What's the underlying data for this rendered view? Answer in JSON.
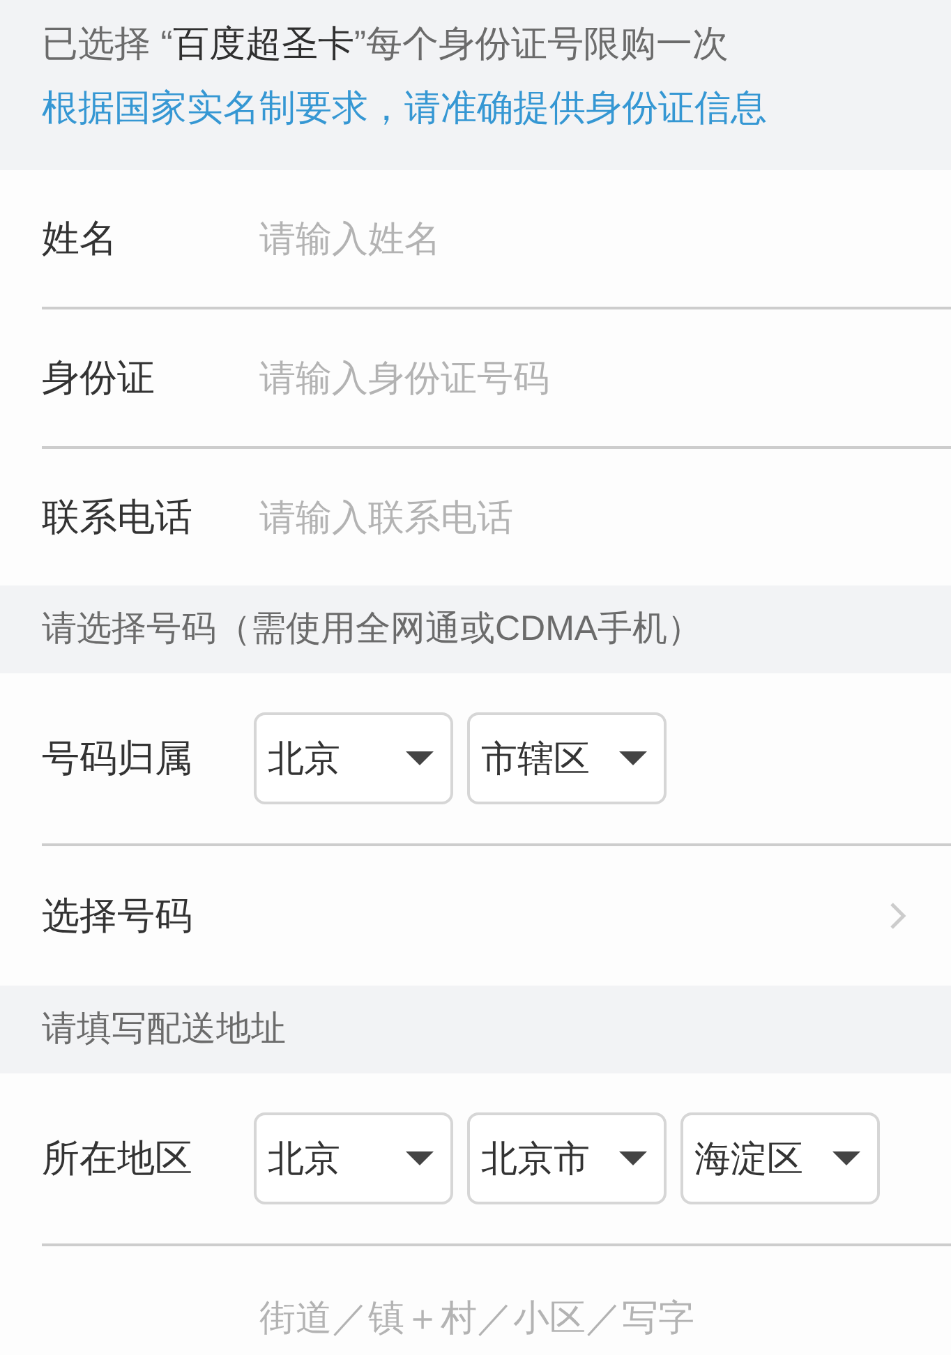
{
  "notice": {
    "segments": [
      {
        "text": "已选择 “",
        "emphasis": false
      },
      {
        "text": "百度超圣卡",
        "emphasis": true
      },
      {
        "text": "”每个身份证号限购一次",
        "emphasis": false
      }
    ],
    "realname_hint": "根据国家实名制要求，请准确提供身份证信息"
  },
  "sections": [
    {
      "rows": [
        {
          "kind": "input",
          "label": "姓名",
          "placeholder": "请输入姓名"
        },
        {
          "kind": "input",
          "label": "身份证",
          "placeholder": "请输入身份证号码"
        },
        {
          "kind": "input",
          "label": "联系电话",
          "placeholder": "请输入联系电话"
        }
      ]
    },
    {
      "header": "请选择号码（需使用全网通或CDMA手机）",
      "rows": [
        {
          "kind": "selects",
          "label": "号码归属",
          "selects": [
            "北京",
            "市辖区"
          ]
        },
        {
          "kind": "link",
          "label": "选择号码"
        }
      ]
    },
    {
      "header": "请填写配送地址",
      "rows": [
        {
          "kind": "selects",
          "label": "所在地区",
          "selects": [
            "北京",
            "北京市",
            "海淀区"
          ]
        },
        {
          "kind": "input",
          "placeholder": "街道／镇＋村／小区／写字"
        }
      ]
    }
  ]
}
